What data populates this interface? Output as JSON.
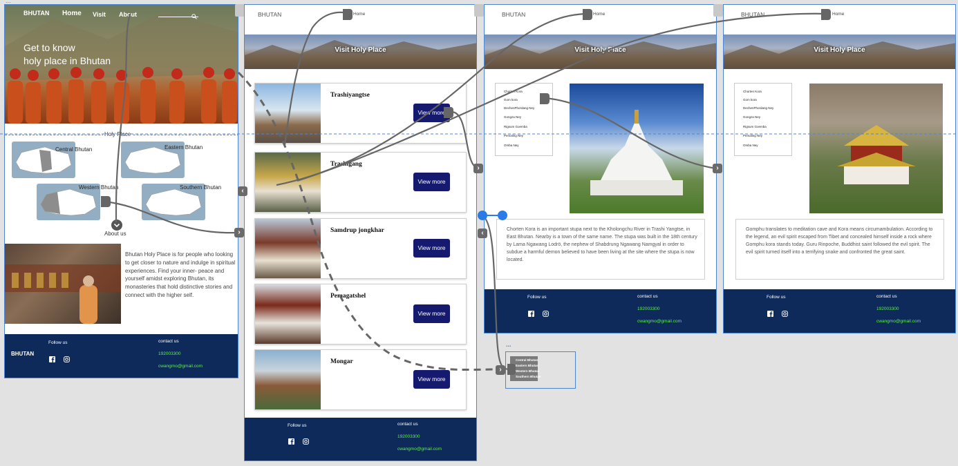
{
  "home": {
    "brand": "BHUTAN",
    "nav": [
      "Home",
      "Visit",
      "About"
    ],
    "hero_line1": "Get to know",
    "hero_line2": "holy place in Bhutan",
    "section_label": "Holy Place",
    "regions": [
      "Central Bhutan",
      "Eastern Bhutan",
      "Western Bhutan",
      "Southern Bhutan"
    ],
    "about_label": "About us",
    "about_text": "Bhutan Holy Place is for people who looking to get closer to nature and indulge in spiritual experiences. Find your inner- peace and yourself amidst exploring Bhutan, its monasteries that hold distinctive stories and connect with the higher self."
  },
  "visit": {
    "brand": "BHUTAN",
    "home_link": "Home",
    "banner_title": "Visit Holy Place",
    "cards": [
      {
        "title": "Trashiyangtse",
        "button": "View more"
      },
      {
        "title": "Trashigang",
        "button": "View more"
      },
      {
        "title": "Samdrup jongkhar",
        "button": "View more"
      },
      {
        "title": "Pemagatshel",
        "button": "View more"
      },
      {
        "title": "Mongar",
        "button": "View more"
      }
    ]
  },
  "detail1": {
    "brand": "BHUTAN",
    "home_link": "Home",
    "banner_title": "Visit Holy Place",
    "list": [
      "Chorten Kora",
      "Gom kora",
      "DechenPhordang Ney",
      "Gongza Ney",
      "Rigsum Goemba",
      "Pemaling Ney",
      "Omba Ney"
    ],
    "description": "Chorten Kora is an important stupa next to the Kholongchu River in Trashi Yangtse, in East Bhutan. Nearby is a town of the same name. The stupa was built in the 18th century by Lama Ngawang Lodrö, the nephew of Shabdrung Ngawang Namgyal in order to subdue a harmful demon believed to have been living at the site where the stupa is now located."
  },
  "detail2": {
    "brand": "BHUTAN",
    "home_link": "Home",
    "banner_title": "Visit Holy Place",
    "list": [
      "Chorten Kora",
      "Gom kora",
      "DechenPhordang Ney",
      "Gongza Ney",
      "Rigsum Goemba",
      "Pemaling Ney",
      "Omba Ney"
    ],
    "description": "Gomphu translates to meditation cave and Kora means circumambulation. According to the legend, an evil spirit escaped from Tibet and concealed himself inside a rock where Gomphu kora stands today. Guru Rinpoche, Buddhist saint followed the evil spirit. The evil spirit turned itself into a terrifying snake and confronted the great saint."
  },
  "footer": {
    "brand": "BHUTAN",
    "follow": "Follow us",
    "contact": "contact us",
    "phone": "192003300",
    "email": "cwangmo@gmail.com"
  },
  "dropdown": {
    "dots": "...",
    "items": [
      "Central Bhutan",
      "Eastern Bhutan",
      "Western Bhutan",
      "Southern Bhutan"
    ]
  },
  "icons": [
    "search-icon",
    "facebook-icon",
    "instagram-icon",
    "chevron-down-icon",
    "chevron-right-icon",
    "chevron-left-icon"
  ],
  "colors": {
    "artboard_border": "#4a86d8",
    "footer_bg": "#0e2a5a",
    "button_bg": "#161a6e",
    "footer_accent": "#5df04a",
    "canvas_bg": "#e2e2e2"
  }
}
